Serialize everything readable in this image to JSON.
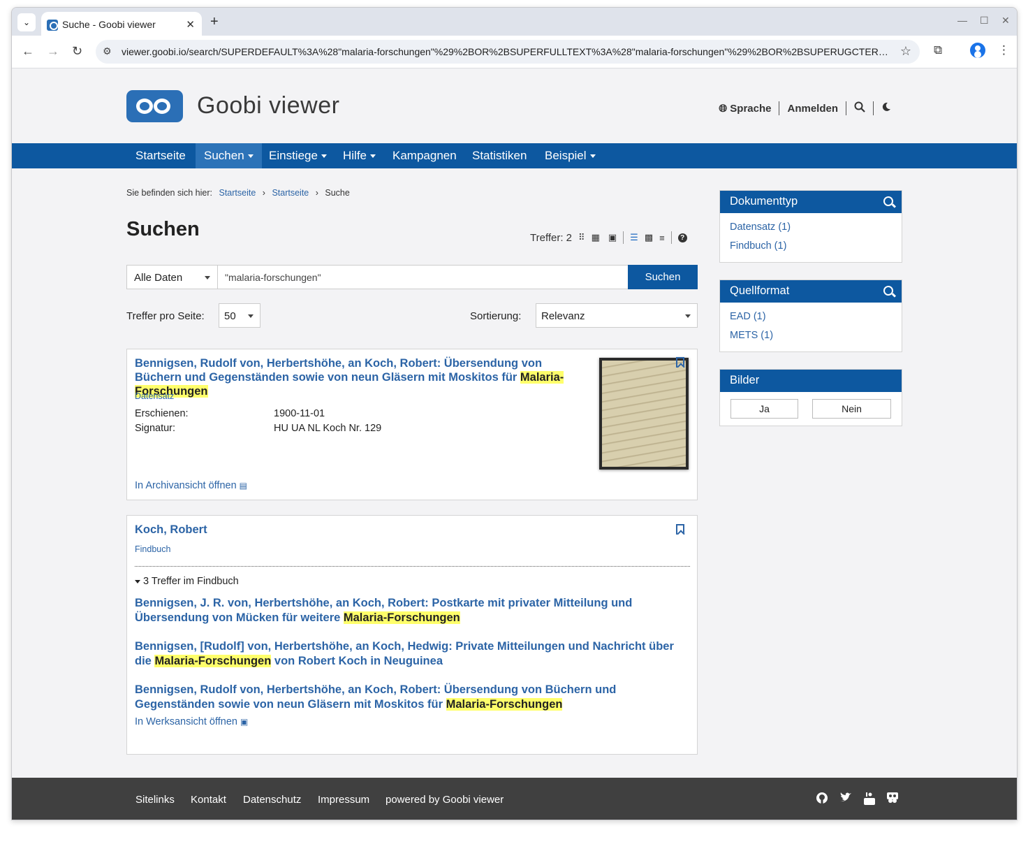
{
  "browser": {
    "tab_title": "Suche - Goobi viewer",
    "url": "viewer.goobi.io/search/SUPERDEFAULT%3A%28\"malaria-forschungen\"%29%2BOR%2BSUPERFULLTEXT%3A%28\"malaria-forschungen\"%29%2BOR%2BSUPERUGCTERMS..."
  },
  "header": {
    "brand": "Goobi viewer",
    "language": "Sprache",
    "login": "Anmelden"
  },
  "nav": {
    "items": [
      "Startseite",
      "Suchen",
      "Einstiege",
      "Hilfe",
      "Kampagnen",
      "Statistiken",
      "Beispiel"
    ]
  },
  "breadcrumb": {
    "prefix": "Sie befinden sich hier:",
    "items": [
      "Startseite",
      "Startseite",
      "Suche"
    ]
  },
  "search": {
    "heading": "Suchen",
    "hits_label": "Treffer: 2",
    "scope": "Alle Daten",
    "query": "\"malaria-forschungen\"",
    "button": "Suchen",
    "per_page_label": "Treffer pro Seite:",
    "per_page_value": "50",
    "sort_label": "Sortierung:",
    "sort_value": "Relevanz"
  },
  "results": [
    {
      "title_pre": "Bennigsen, Rudolf von, Herbertshöhe, an Koch, Robert: Übersendung von Büchern und Gegenständen sowie von neun Gläsern mit Moskitos für ",
      "title_hl": "Malaria-Forschungen",
      "type": "Datensatz",
      "meta": [
        {
          "key": "Erschienen:",
          "value": "1900-11-01"
        },
        {
          "key": "Signatur:",
          "value": "HU UA NL Koch Nr. 129"
        }
      ],
      "link": "In Archivansicht öffnen"
    },
    {
      "title": "Koch, Robert",
      "type": "Findbuch",
      "toggle": "3 Treffer im Findbuch",
      "subhits": [
        {
          "pre": "Bennigsen, J. R. von, Herbertshöhe, an Koch, Robert: Postkarte mit privater Mitteilung und Übersendung von Mücken für weitere ",
          "hl": "Malaria-Forschungen",
          "post": ""
        },
        {
          "pre": "Bennigsen, [Rudolf] von, Herbertshöhe, an Koch, Hedwig: Private Mitteilungen und Nachricht über die ",
          "hl": "Malaria-Forschungen",
          "post": " von Robert Koch in Neuguinea"
        },
        {
          "pre": "Bennigsen, Rudolf von, Herbertshöhe, an Koch, Robert: Übersendung von Büchern und Gegenständen sowie von neun Gläsern mit Moskitos für ",
          "hl": "Malaria-Forschungen",
          "post": ""
        }
      ],
      "link": "In Werksansicht öffnen"
    }
  ],
  "facets": {
    "doctype": {
      "title": "Dokumenttyp",
      "items": [
        "Datensatz (1)",
        "Findbuch (1)"
      ]
    },
    "source": {
      "title": "Quellformat",
      "items": [
        "EAD (1)",
        "METS (1)"
      ]
    },
    "images": {
      "title": "Bilder",
      "yes": "Ja",
      "no": "Nein"
    }
  },
  "footer": {
    "links": [
      "Sitelinks",
      "Kontakt",
      "Datenschutz",
      "Impressum",
      "powered by Goobi viewer"
    ]
  }
}
